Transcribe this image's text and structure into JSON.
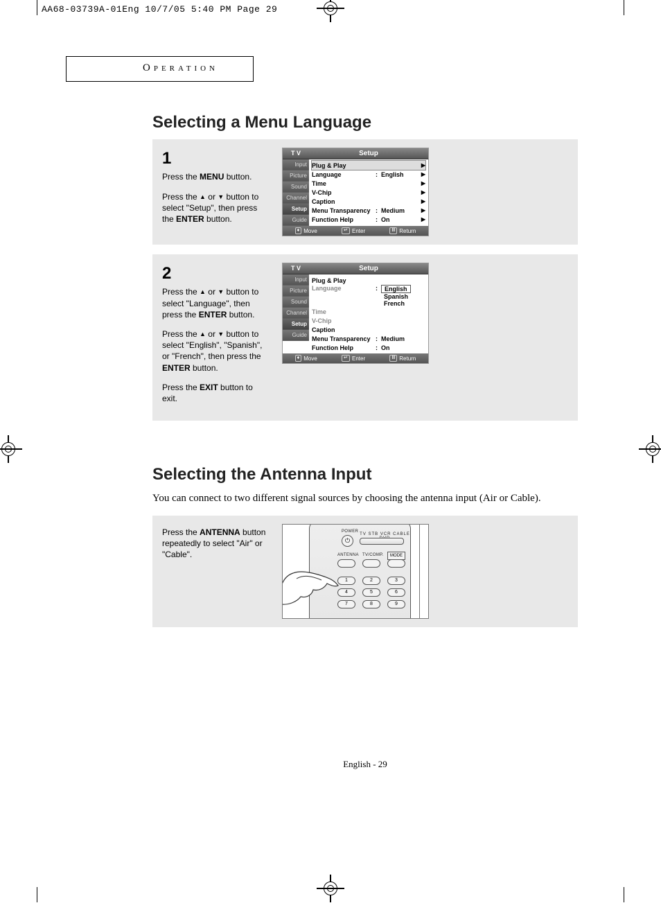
{
  "print_header": "AA68-03739A-01Eng  10/7/05  5:40 PM  Page 29",
  "section_tab": "Operation",
  "title1": "Selecting a Menu Language",
  "step1": {
    "num": "1",
    "p1_a": "Press the ",
    "p1_b": "MENU",
    "p1_c": " button.",
    "p2_a": "Press the ",
    "p2_b": " or ",
    "p2_c": " button to select \"Setup\", then press the ",
    "p2_d": "ENTER",
    "p2_e": " button."
  },
  "step2": {
    "num": "2",
    "p1_a": "Press the ",
    "p1_b": " or ",
    "p1_c": " button to select \"Language\", then press the ",
    "p1_d": "ENTER",
    "p1_e": " button.",
    "p2_a": "Press the ",
    "p2_b": " or ",
    "p2_c": " button to select \"English\", \"Spanish\", or \"French\", then press the ",
    "p2_d": "ENTER",
    "p2_e": " button.",
    "p3_a": "Press the ",
    "p3_b": "EXIT",
    "p3_c": " button to exit."
  },
  "osd": {
    "tv": "T V",
    "title": "Setup",
    "side": [
      "Input",
      "Picture",
      "Sound",
      "Channel",
      "Setup",
      "Guide"
    ],
    "rows1": [
      {
        "label": "Plug & Play",
        "colon": "",
        "val": "",
        "caret": "▶",
        "hl": true
      },
      {
        "label": "Language",
        "colon": ":",
        "val": "English",
        "caret": "▶"
      },
      {
        "label": "Time",
        "colon": "",
        "val": "",
        "caret": "▶"
      },
      {
        "label": "V-Chip",
        "colon": "",
        "val": "",
        "caret": "▶"
      },
      {
        "label": "Caption",
        "colon": "",
        "val": "",
        "caret": "▶"
      },
      {
        "label": "Menu Transparency",
        "colon": ":",
        "val": "Medium",
        "caret": "▶"
      },
      {
        "label": "Function Help",
        "colon": ":",
        "val": "On",
        "caret": "▶"
      }
    ],
    "rows2": [
      {
        "label": "Plug & Play",
        "colon": "",
        "val": ""
      },
      {
        "label": "Language",
        "colon": ":",
        "opts": [
          "English",
          "Spanish",
          "French"
        ]
      },
      {
        "label": "Time",
        "colon": "",
        "val": ""
      },
      {
        "label": "V-Chip",
        "colon": "",
        "val": ""
      },
      {
        "label": "Caption",
        "colon": "",
        "val": ""
      },
      {
        "label": "Menu Transparency",
        "colon": ":",
        "val": "Medium"
      },
      {
        "label": "Function Help",
        "colon": ":",
        "val": "On"
      }
    ],
    "footer": {
      "move": "Move",
      "enter": "Enter",
      "return": "Return"
    }
  },
  "title2": "Selecting the Antenna Input",
  "intro2": "You can connect to two different signal sources by choosing the antenna input (Air or Cable).",
  "step3": {
    "p1_a": "Press the ",
    "p1_b": "ANTENNA",
    "p1_c": " button repeatedly to select \"Air\" or \"Cable\"."
  },
  "remote": {
    "power": "POWER",
    "indicators": "TV  STB  VCR CABLE  DVD",
    "antenna": "ANTENNA",
    "tvcomp": "TV/COMP.",
    "mode": "MODE",
    "keys": [
      "1",
      "2",
      "3",
      "4",
      "5",
      "6",
      "7",
      "8",
      "9"
    ]
  },
  "page_num": "English - 29"
}
